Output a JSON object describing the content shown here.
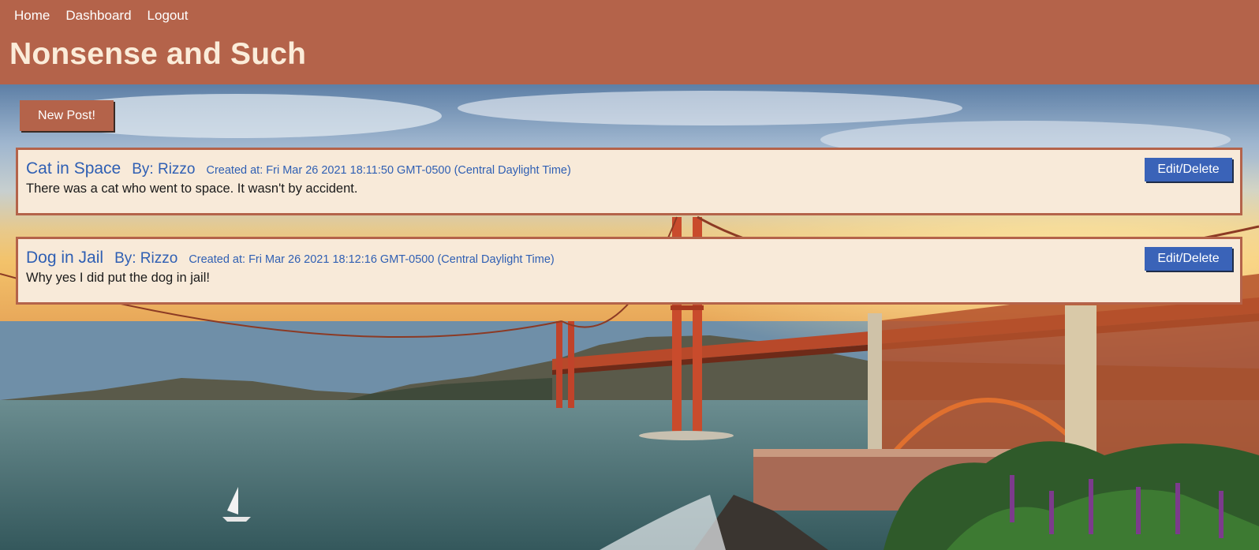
{
  "nav": {
    "items": [
      "Home",
      "Dashboard",
      "Logout"
    ]
  },
  "site": {
    "title": "Nonsense and Such"
  },
  "actions": {
    "new_post_label": "New Post!"
  },
  "posts": [
    {
      "title": "Cat in Space",
      "author": "By: Rizzo",
      "created": "Created at: Fri Mar 26 2021 18:11:50 GMT-0500 (Central Daylight Time)",
      "body": "There was a cat who went to space. It wasn't by accident.",
      "edit_label": "Edit/Delete"
    },
    {
      "title": "Dog in Jail",
      "author": "By: Rizzo",
      "created": "Created at: Fri Mar 26 2021 18:12:16 GMT-0500 (Central Daylight Time)",
      "body": "Why yes I did put the dog in jail!",
      "edit_label": "Edit/Delete"
    }
  ],
  "colors": {
    "header_bg": "#b4634a",
    "title_text": "#fbecd9",
    "post_bg": "#f8ead9",
    "post_border": "#b4634a",
    "link_blue": "#2f5fb3",
    "edit_button": "#3a63b8"
  },
  "background_image": "golden-gate-bridge-sunset-photo"
}
